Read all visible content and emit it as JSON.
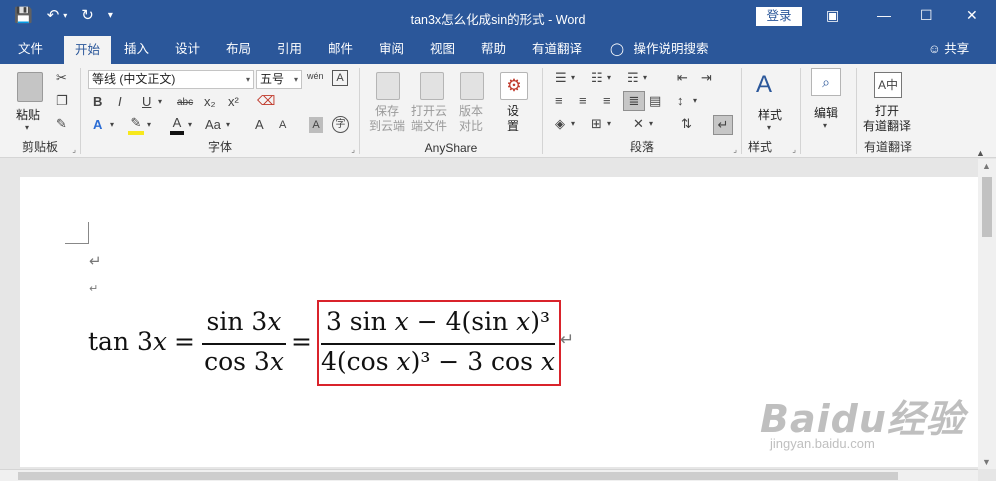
{
  "title_bar": {
    "qat": {
      "save_icon": "save-icon",
      "undo_icon": "undo-icon",
      "redo_icon": "redo-icon",
      "customize_icon": "customize-qat-icon"
    },
    "doc_title": "tan3x怎么化成sin的形式  -  Word",
    "login_label": "登录",
    "controls": [
      "ribbon-display-icon",
      "minimize-icon",
      "maximize-icon",
      "close-icon"
    ]
  },
  "tabs": [
    "文件",
    "开始",
    "插入",
    "设计",
    "布局",
    "引用",
    "邮件",
    "审阅",
    "视图",
    "帮助",
    "有道翻译"
  ],
  "active_tab": "开始",
  "tell_me": "操作说明搜索",
  "share": "共享",
  "ribbon": {
    "clipboard": {
      "paste": "粘贴",
      "group": "剪贴板"
    },
    "font": {
      "font_name": "等线 (中文正文)",
      "font_size": "五号",
      "group": "字体",
      "wen_label": "wén",
      "format_buttons": [
        "B",
        "I",
        "U",
        "abc",
        "x₂",
        "x²"
      ],
      "row3": [
        "A",
        "A",
        "Aa",
        "A",
        "A",
        "A",
        "字"
      ]
    },
    "anyshare": {
      "save_cloud": [
        "保存",
        "到云端"
      ],
      "open_cloud": [
        "打开云",
        "端文件"
      ],
      "compare": [
        "版本",
        "对比"
      ],
      "settings": [
        "设",
        "置"
      ],
      "group": "AnyShare"
    },
    "paragraph": {
      "group": "段落"
    },
    "styles": {
      "label": "样式",
      "group": "样式"
    },
    "editing": {
      "label": "编辑"
    },
    "youdao": {
      "open": [
        "打开",
        "有道翻译"
      ],
      "group": "有道翻译"
    }
  },
  "document": {
    "paragraph_marks": [
      "↵",
      "↵",
      "↵"
    ],
    "equation": {
      "lhs": "tan 3𝑥",
      "eq1": "=",
      "frac1": {
        "num": "sin 3𝑥",
        "den": "cos 3𝑥"
      },
      "eq2": "=",
      "frac2": {
        "num": "3 sin 𝑥 − 4(sin 𝑥)³",
        "den": "4(cos 𝑥)³ − 3 cos 𝑥"
      }
    },
    "highlight_color": "#d9232b"
  },
  "watermark": {
    "brand": "Baidu经验",
    "url": "jingyan.baidu.com"
  },
  "colors": {
    "title_bar": "#2b579a",
    "ribbon": "#f3f3f3"
  }
}
